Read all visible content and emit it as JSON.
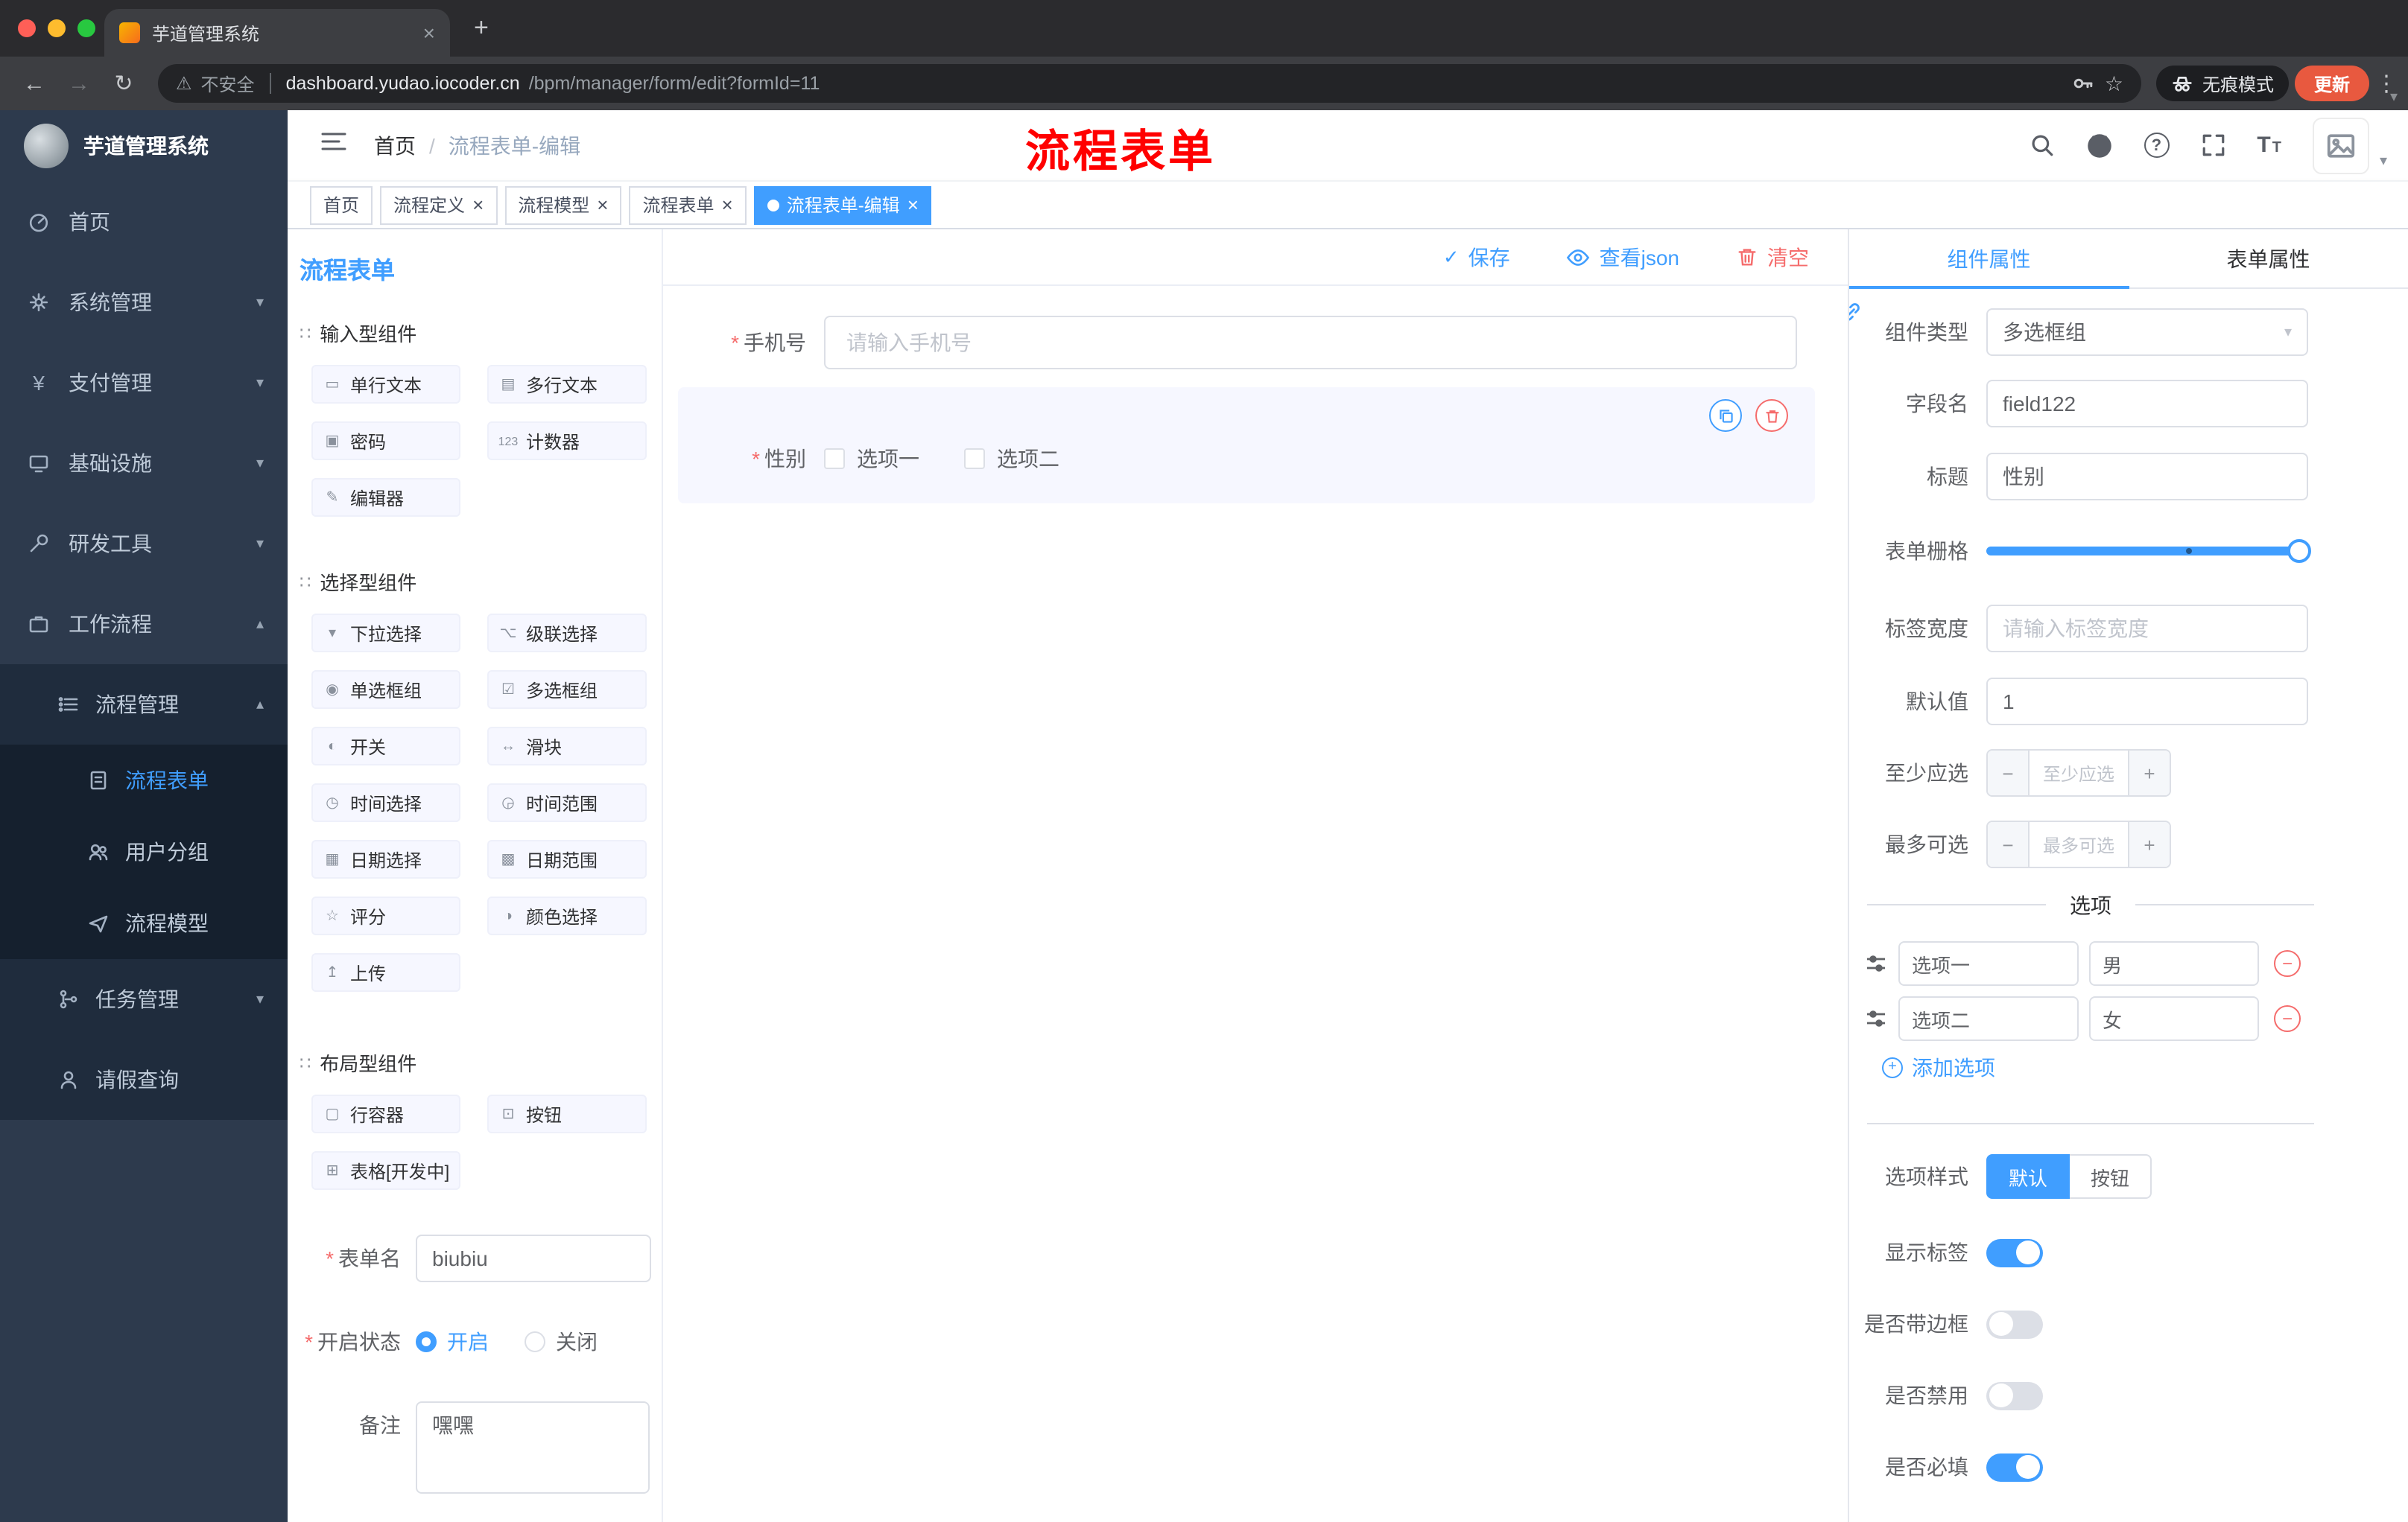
{
  "colors": {
    "primary": "#409eff",
    "danger": "#f56c6c",
    "sidebar_bg": "#2d3a4d",
    "update_pill": "#e8593f"
  },
  "icons": {
    "back": "←",
    "forward": "→",
    "reload": "↻",
    "warning": "⚠",
    "star": "☆",
    "dots": "⋮",
    "caret_down": "▾",
    "caret_up": "▴",
    "plus": "+",
    "close": "×",
    "check": "✓",
    "question": "?",
    "grip": "∷",
    "minus": "−",
    "font_big": "T",
    "font_small": "T",
    "slash": "/",
    "yen": "¥",
    "asterisk": "*"
  },
  "browser": {
    "tab_title": "芋道管理系统",
    "security_label": "不安全",
    "url_host": "dashboard.yudao.iocoder.cn",
    "url_path": "/bpm/manager/form/edit?formId=11",
    "incognito_label": "无痕模式",
    "update_label": "更新"
  },
  "annotation": {
    "text": "流程表单"
  },
  "sidebar": {
    "logo_title": "芋道管理系统",
    "items": [
      {
        "label": "首页"
      },
      {
        "label": "系统管理"
      },
      {
        "label": "支付管理"
      },
      {
        "label": "基础设施"
      },
      {
        "label": "研发工具"
      },
      {
        "label": "工作流程",
        "children": [
          {
            "label": "流程管理",
            "children": [
              {
                "label": "流程表单"
              },
              {
                "label": "用户分组"
              },
              {
                "label": "流程模型"
              }
            ]
          },
          {
            "label": "任务管理"
          },
          {
            "label": "请假查询"
          }
        ]
      }
    ]
  },
  "header": {
    "breadcrumb_home": "首页",
    "breadcrumb_current": "流程表单-编辑"
  },
  "tags": [
    {
      "label": "首页"
    },
    {
      "label": "流程定义"
    },
    {
      "label": "流程模型"
    },
    {
      "label": "流程表单"
    },
    {
      "label": "流程表单-编辑"
    }
  ],
  "palette": {
    "title": "流程表单",
    "sections": [
      {
        "label": "输入型组件",
        "items": [
          {
            "label": "单行文本",
            "glyph": "▭"
          },
          {
            "label": "多行文本",
            "glyph": "▤"
          },
          {
            "label": "密码",
            "glyph": "▣"
          },
          {
            "label": "计数器",
            "glyph": "123"
          },
          {
            "label": "编辑器",
            "glyph": "✎"
          }
        ]
      },
      {
        "label": "选择型组件",
        "items": [
          {
            "label": "下拉选择",
            "glyph": "▾"
          },
          {
            "label": "级联选择",
            "glyph": "⌥"
          },
          {
            "label": "单选框组",
            "glyph": "◉"
          },
          {
            "label": "多选框组",
            "glyph": "☑"
          },
          {
            "label": "开关",
            "glyph": "◐"
          },
          {
            "label": "滑块",
            "glyph": "↔"
          },
          {
            "label": "时间选择",
            "glyph": "◷"
          },
          {
            "label": "时间范围",
            "glyph": "◶"
          },
          {
            "label": "日期选择",
            "glyph": "▦"
          },
          {
            "label": "日期范围",
            "glyph": "▩"
          },
          {
            "label": "评分",
            "glyph": "☆"
          },
          {
            "label": "颜色选择",
            "glyph": "◑"
          },
          {
            "label": "上传",
            "glyph": "↥"
          }
        ]
      },
      {
        "label": "布局型组件",
        "items": [
          {
            "label": "行容器",
            "glyph": "▢"
          },
          {
            "label": "按钮",
            "glyph": "⊡"
          },
          {
            "label": "表格[开发中]",
            "glyph": "⊞"
          }
        ]
      }
    ],
    "form": {
      "name_label": "表单名",
      "name_value": "biubiu",
      "status_label": "开启状态",
      "status_on": "开启",
      "status_off": "关闭",
      "remark_label": "备注",
      "remark_value": "嘿嘿"
    }
  },
  "canvas": {
    "toolbar": {
      "save": "保存",
      "view_json": "查看json",
      "clear": "清空"
    },
    "phone": {
      "label": "手机号",
      "placeholder": "请输入手机号"
    },
    "gender": {
      "label": "性别",
      "option1": "选项一",
      "option2": "选项二"
    }
  },
  "props": {
    "tab_component": "组件属性",
    "tab_form": "表单属性",
    "component_type": {
      "label": "组件类型",
      "value": "多选框组"
    },
    "field_name": {
      "label": "字段名",
      "value": "field122"
    },
    "title": {
      "label": "标题",
      "value": "性别"
    },
    "grid": {
      "label": "表单栅格"
    },
    "label_width": {
      "label": "标签宽度",
      "placeholder": "请输入标签宽度"
    },
    "default_value": {
      "label": "默认值",
      "value": "1"
    },
    "min_select": {
      "label": "至少应选",
      "placeholder": "至少应选"
    },
    "max_select": {
      "label": "最多可选",
      "placeholder": "最多可选"
    },
    "options_title": "选项",
    "options": [
      {
        "label": "选项一",
        "value": "男"
      },
      {
        "label": "选项二",
        "value": "女"
      }
    ],
    "add_option": "添加选项",
    "option_style": {
      "label": "选项样式",
      "default": "默认",
      "button": "按钮"
    },
    "show_label": {
      "label": "显示标签",
      "on": true
    },
    "border": {
      "label": "是否带边框",
      "on": false
    },
    "disabled": {
      "label": "是否禁用",
      "on": false
    },
    "required": {
      "label": "是否必填",
      "on": true
    }
  }
}
